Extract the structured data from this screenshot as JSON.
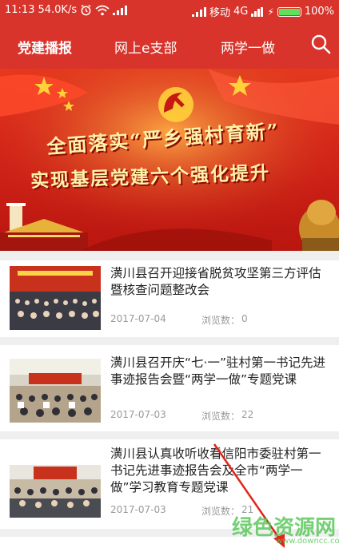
{
  "status_bar": {
    "time": "11:13",
    "speed": "54.0K/s",
    "carrier": "移动",
    "network": "4G",
    "battery": "100%"
  },
  "nav": {
    "tabs": [
      {
        "label": "党建播报"
      },
      {
        "label": "网上e支部"
      },
      {
        "label": "两学一做"
      }
    ],
    "active_tab": "党建播报",
    "icons": [
      "search-icon"
    ]
  },
  "banner": {
    "line1": "全面落实“严乡强村育新”",
    "line2": "实现基层党建六个强化提升"
  },
  "articles": [
    {
      "title": "潢川县召开迎接省脱贫攻坚第三方评估暨核查问题整改会",
      "date": "2017-07-04",
      "views_label": "浏览数：",
      "views": "0"
    },
    {
      "title": "潢川县召开庆“七·一”驻村第一书记先进事迹报告会暨“两学一做”专题党课",
      "date": "2017-07-03",
      "views_label": "浏览数：",
      "views": "22"
    },
    {
      "title": "潢川县认真收听收看信阳市委驻村第一书记先进事迹报告会及全市“两学一做”学习教育专题党课",
      "date": "2017-07-03",
      "views_label": "浏览数：",
      "views": "21"
    }
  ],
  "watermark": {
    "text": "绿色资源网",
    "url": "www.downcc.com"
  },
  "colors": {
    "primary": "#d8342b",
    "battery": "#5ee15a",
    "watermark": "#5cc85c"
  }
}
